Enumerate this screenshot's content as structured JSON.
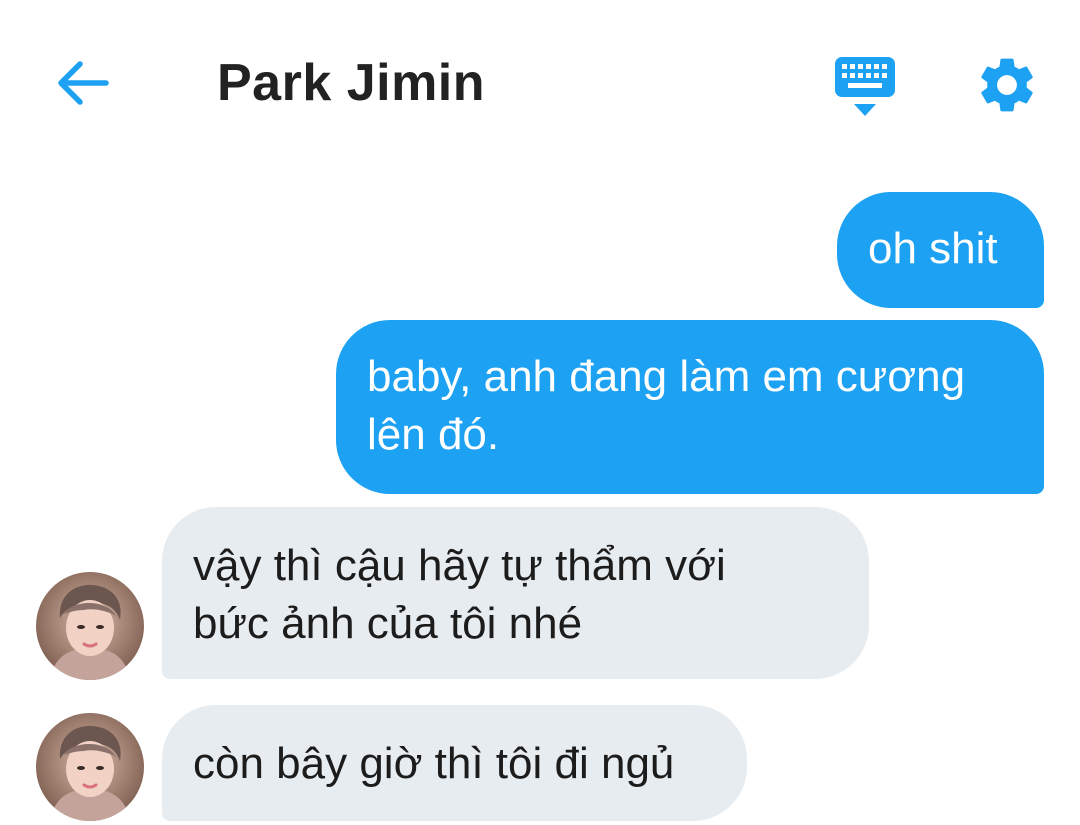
{
  "header": {
    "title": "Park Jimin",
    "back_icon": "back-arrow-icon",
    "keyboard_icon": "keyboard-icon",
    "settings_icon": "gear-icon"
  },
  "colors": {
    "accent": "#1da1f2",
    "incoming_bubble": "#e6ecf0",
    "title": "#222222"
  },
  "messages": [
    {
      "direction": "out",
      "text": "oh shit"
    },
    {
      "direction": "out",
      "text": "baby, anh đang làm em cương\nlên đó."
    },
    {
      "direction": "in",
      "text": "vậy thì cậu hãy tự thẩm với\nbức ảnh của tôi nhé",
      "avatar": "avatar-icon"
    },
    {
      "direction": "in",
      "text": "còn bây giờ thì tôi đi ngủ",
      "avatar": "avatar-icon"
    }
  ]
}
